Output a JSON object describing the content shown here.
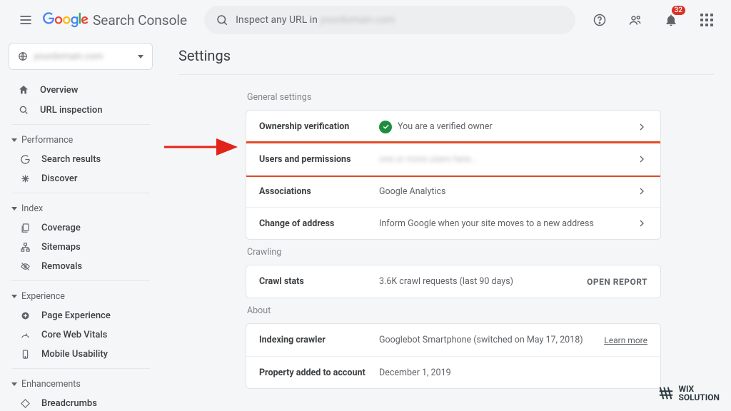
{
  "header": {
    "product_name": "Search Console",
    "search_prefix": "Inspect any URL in ",
    "notif_count": "32"
  },
  "sidebar": {
    "property_blur": "yourdomain.com",
    "top": [
      {
        "label": "Overview"
      },
      {
        "label": "URL inspection"
      }
    ],
    "groups": [
      {
        "title": "Performance",
        "items": [
          {
            "label": "Search results"
          },
          {
            "label": "Discover"
          }
        ]
      },
      {
        "title": "Index",
        "items": [
          {
            "label": "Coverage"
          },
          {
            "label": "Sitemaps"
          },
          {
            "label": "Removals"
          }
        ]
      },
      {
        "title": "Experience",
        "items": [
          {
            "label": "Page Experience"
          },
          {
            "label": "Core Web Vitals"
          },
          {
            "label": "Mobile Usability"
          }
        ]
      },
      {
        "title": "Enhancements",
        "items": [
          {
            "label": "Breadcrumbs"
          }
        ]
      }
    ]
  },
  "main": {
    "title": "Settings",
    "sections": {
      "general": {
        "label": "General settings",
        "rows": [
          {
            "label": "Ownership verification",
            "value": "You are a verified owner",
            "check": true,
            "chevron": true
          },
          {
            "label": "Users and permissions",
            "value": "blurred",
            "blur": true,
            "chevron": true,
            "highlight": true
          },
          {
            "label": "Associations",
            "value": "Google Analytics",
            "chevron": true
          },
          {
            "label": "Change of address",
            "value": "Inform Google when your site moves to a new address",
            "chevron": true
          }
        ]
      },
      "crawling": {
        "label": "Crawling",
        "rows": [
          {
            "label": "Crawl stats",
            "value": "3.6K crawl requests (last 90 days)",
            "action": "OPEN REPORT"
          }
        ]
      },
      "about": {
        "label": "About",
        "rows": [
          {
            "label": "Indexing crawler",
            "value": "Googlebot Smartphone (switched on May 17, 2018)",
            "learn": "Learn more"
          },
          {
            "label": "Property added to account",
            "value": "December 1, 2019"
          }
        ]
      }
    }
  },
  "watermark": {
    "line1": "WIX",
    "line2": "SOLUTION"
  }
}
